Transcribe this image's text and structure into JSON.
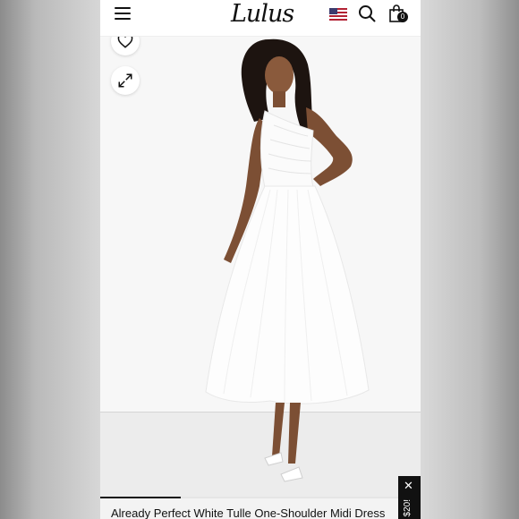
{
  "header": {
    "menu_icon": "hamburger-menu-icon",
    "logo_text": "Lulus",
    "flag_icon": "us-flag-icon",
    "search_icon": "search-icon",
    "bag_icon": "shopping-bag-icon",
    "bag_count": "0"
  },
  "product": {
    "title": "Already Perfect White Tulle One-Shoulder Midi Dress",
    "favorite_icon": "heart-icon",
    "expand_icon": "expand-icon",
    "gallery_progress": 0.25
  },
  "promo": {
    "close_icon": "close-icon",
    "text": "$20!"
  },
  "colors": {
    "accent": "#111111",
    "background": "#ffffff",
    "photo_backdrop": "#f7f7f7",
    "flag_red": "#b22234",
    "flag_blue": "#3c3b6e"
  }
}
